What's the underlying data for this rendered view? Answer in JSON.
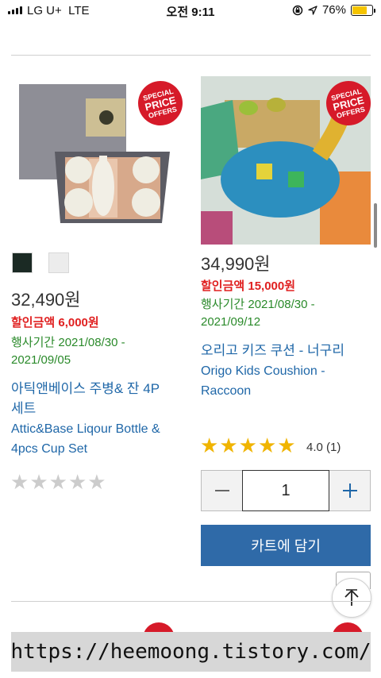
{
  "status_bar": {
    "carrier": "LG U+",
    "network": "LTE",
    "time": "오전 9:11",
    "battery_percent": "76%",
    "battery_level": 0.76,
    "icons": [
      "signal-icon",
      "lock-rotation-icon",
      "location-icon",
      "battery-icon"
    ]
  },
  "products": [
    {
      "badge": {
        "line1": "SPECIAL",
        "line2": "PRICE",
        "line3": "OFFERS"
      },
      "color_swatches": [
        "#1b2a24",
        "#ececec"
      ],
      "price": "32,490원",
      "discount": "할인금액 6,000원",
      "period_line1": "행사기간 2021/08/30 -",
      "period_line2": "2021/09/05",
      "name_ko_line1": "아틱앤베이스 주병& 잔 4P",
      "name_ko_line2": "세트",
      "name_en_line1": "Attic&Base Liqour Bottle &",
      "name_en_line2": "4pcs Cup Set",
      "rating_stars": 0
    },
    {
      "badge": {
        "line1": "SPECIAL",
        "line2": "PRICE",
        "line3": "OFFERS"
      },
      "price": "34,990원",
      "discount": "할인금액 15,000원",
      "period_line1": "행사기간 2021/08/30 -",
      "period_line2": "2021/09/12",
      "name_ko": "오리고 키즈 쿠션 - 너구리",
      "name_en_line1": "Origo Kids Coushion -",
      "name_en_line2": "Raccoon",
      "rating_stars": 5,
      "rating_text": "4.0 (1)",
      "quantity": "1",
      "add_to_cart": "카트에 담기"
    }
  ],
  "colors": {
    "price_text": "#333333",
    "discount_red": "#e02020",
    "period_green": "#2a8a2a",
    "link_blue": "#1f67a8",
    "cart_button": "#2f6aa8",
    "star_gold": "#f0b400",
    "star_empty": "#cccccc",
    "badge_red": "#d61a29"
  },
  "watermark_url": "https://heemoong.tistory.com/"
}
